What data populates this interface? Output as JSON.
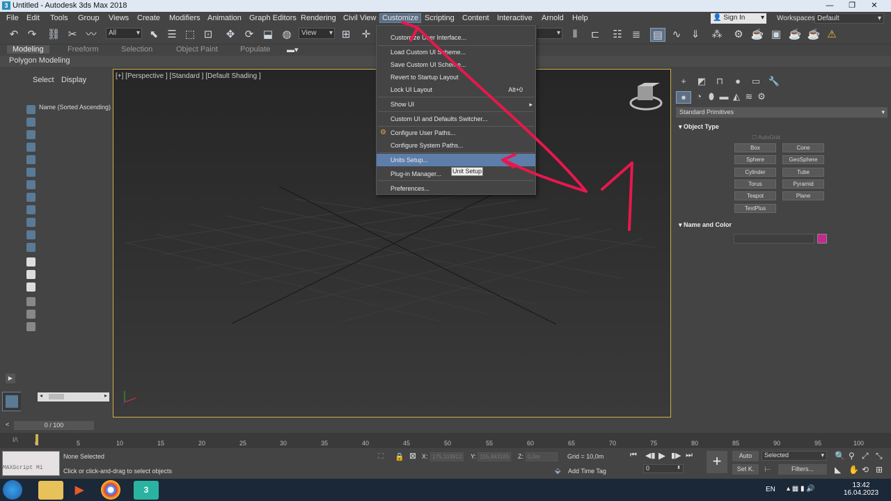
{
  "window": {
    "title": "Untitled - Autodesk 3ds Max 2018",
    "app_icon_text": "3"
  },
  "menubar": {
    "items": [
      "File",
      "Edit",
      "Tools",
      "Group",
      "Views",
      "Create",
      "Modifiers",
      "Animation",
      "Graph Editors",
      "Rendering",
      "Civil View",
      "Customize",
      "Scripting",
      "Content",
      "Interactive",
      "Arnold",
      "Help"
    ],
    "active": "Customize",
    "signin": "Sign In",
    "workspaces_label": "Workspaces:",
    "workspace_value": "Default"
  },
  "toolbar": {
    "selection_filter": "All",
    "ref_coord": "View"
  },
  "ribbon": {
    "tabs": [
      "Modeling",
      "Freeform",
      "Selection",
      "Object Paint",
      "Populate"
    ],
    "active": "Modeling",
    "subtitle": "Polygon Modeling"
  },
  "scene_explorer": {
    "tab_select": "Select",
    "tab_display": "Display",
    "sort_label": "Name (Sorted Ascending)"
  },
  "viewport": {
    "label": "[+] [Perspective ] [Standard ] [Default Shading ]"
  },
  "customize_menu": {
    "items": [
      {
        "label": "Customize User Interface...",
        "accel": "",
        "submenu": false
      },
      {
        "label": "Load Custom UI Scheme...",
        "accel": "",
        "submenu": false
      },
      {
        "label": "Save Custom UI Scheme...",
        "accel": "",
        "submenu": false
      },
      {
        "label": "Revert to Startup Layout",
        "accel": "",
        "submenu": false
      },
      {
        "label": "Lock UI Layout",
        "accel": "Alt+0",
        "submenu": false
      },
      {
        "label": "Show UI",
        "accel": "",
        "submenu": true
      },
      {
        "label": "Custom UI and Defaults Switcher...",
        "accel": "",
        "submenu": false
      },
      {
        "label": "Configure User Paths...",
        "accel": "",
        "submenu": false
      },
      {
        "label": "Configure System Paths...",
        "accel": "",
        "submenu": false
      },
      {
        "label": "Units Setup...",
        "accel": "",
        "submenu": false
      },
      {
        "label": "Plug-in Manager...",
        "accel": "",
        "submenu": false
      },
      {
        "label": "Preferences...",
        "accel": "",
        "submenu": false
      }
    ],
    "highlighted": "Units Setup...",
    "tooltip": "Unit Setup"
  },
  "command_panel": {
    "primitive_type": "Standard Primitives",
    "object_type_title": "Object Type",
    "autogrid": "AutoGrid",
    "buttons": [
      "Box",
      "Cone",
      "Sphere",
      "GeoSphere",
      "Cylinder",
      "Tube",
      "Torus",
      "Pyramid",
      "Teapot",
      "Plane",
      "TextPlus"
    ],
    "name_color_title": "Name and Color",
    "color": "#c5298e"
  },
  "timeline": {
    "slider_text": "0 / 100",
    "ticks": [
      "0",
      "5",
      "10",
      "15",
      "20",
      "25",
      "30",
      "35",
      "40",
      "45",
      "50",
      "55",
      "60",
      "65",
      "70",
      "75",
      "80",
      "85",
      "90",
      "95",
      "100"
    ]
  },
  "status": {
    "maxscript": "MAXScript Mi",
    "selection": "None Selected",
    "prompt": "Click or click-and-drag to select objects",
    "x_label": "X:",
    "x_value": "175,103912",
    "y_label": "Y:",
    "y_value": "155,463165",
    "z_label": "Z:",
    "z_value": "0,0m",
    "grid": "Grid = 10,0m",
    "add_time_tag": "Add Time Tag",
    "frame_value": "0",
    "auto_label": "Auto",
    "setk_label": "Set K.",
    "selected_value": "Selected",
    "filters_label": "Filters..."
  },
  "taskbar": {
    "lang": "EN",
    "time": "13:42",
    "date": "16.04.2023",
    "max_icon_text": "3"
  }
}
